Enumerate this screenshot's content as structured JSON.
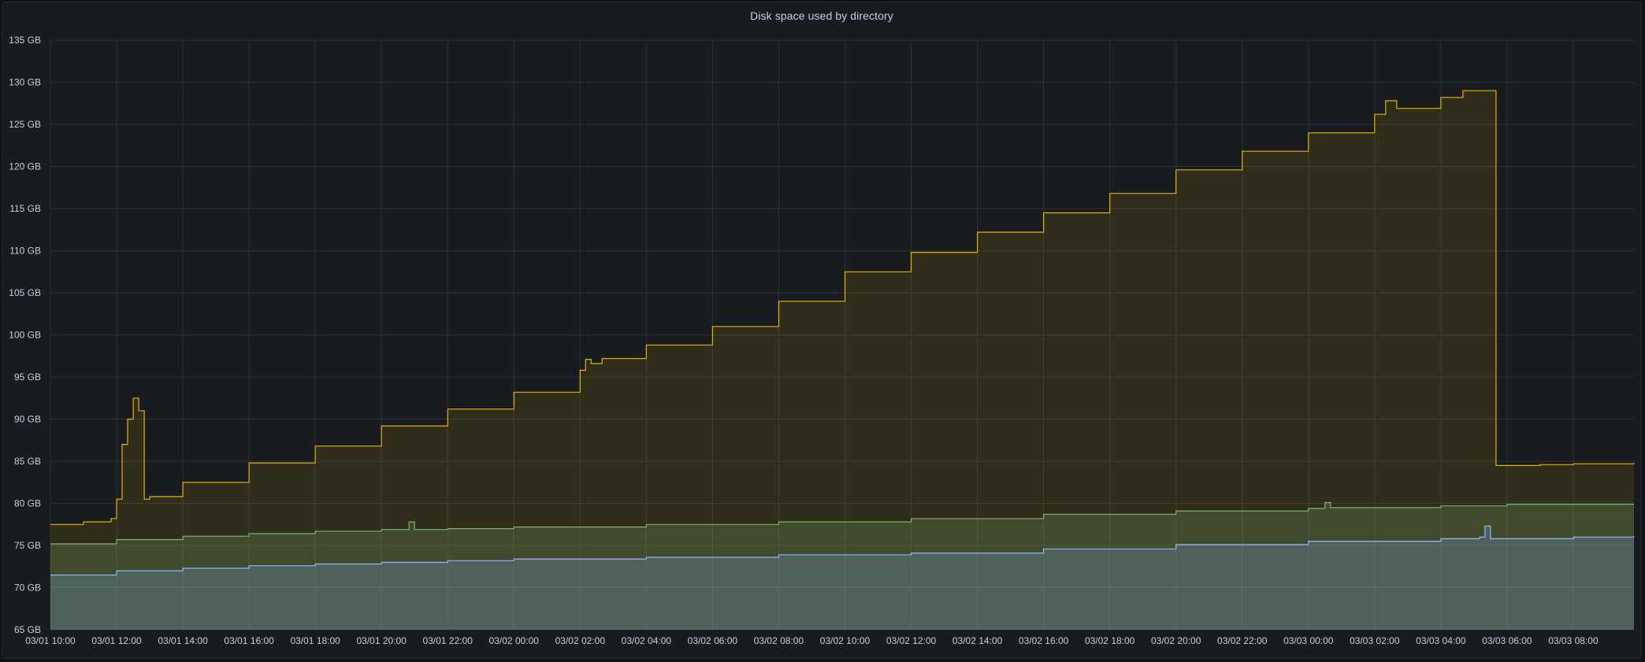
{
  "panel": {
    "title": "Disk space used by directory"
  },
  "colors": {
    "background": "#181b1f",
    "grid": "#2c3035",
    "series_yellow": "#e0b400",
    "series_green": "#7eb26d",
    "series_blue": "#8ab8ff"
  },
  "chart_data": {
    "type": "area",
    "title": "Disk space used by directory",
    "xlabel": "",
    "ylabel": "",
    "ylim": [
      65,
      135
    ],
    "y_unit": "GB",
    "y_ticks": [
      "65 GB",
      "70 GB",
      "75 GB",
      "80 GB",
      "85 GB",
      "90 GB",
      "95 GB",
      "100 GB",
      "105 GB",
      "110 GB",
      "115 GB",
      "120 GB",
      "125 GB",
      "130 GB",
      "135 GB"
    ],
    "y_tick_values": [
      65,
      70,
      75,
      80,
      85,
      90,
      95,
      100,
      105,
      110,
      115,
      120,
      125,
      130,
      135
    ],
    "xlim": [
      "03/01 10:00",
      "03/03 09:50"
    ],
    "x_ticks": [
      "03/01 10:00",
      "03/01 12:00",
      "03/01 14:00",
      "03/01 16:00",
      "03/01 18:00",
      "03/01 20:00",
      "03/01 22:00",
      "03/02 00:00",
      "03/02 02:00",
      "03/02 04:00",
      "03/02 06:00",
      "03/02 08:00",
      "03/02 10:00",
      "03/02 12:00",
      "03/02 14:00",
      "03/02 16:00",
      "03/02 18:00",
      "03/02 20:00",
      "03/02 22:00",
      "03/03 00:00",
      "03/03 02:00",
      "03/03 04:00",
      "03/03 06:00",
      "03/03 08:00"
    ],
    "grid": true,
    "legend": "none",
    "stacked": false,
    "interpolation": "step",
    "series": [
      {
        "color": "#e0b400",
        "x": [
          "03/01 10:00",
          "03/01 11:00",
          "03/01 11:50",
          "03/01 12:00",
          "03/01 12:10",
          "03/01 12:20",
          "03/01 12:30",
          "03/01 12:40",
          "03/01 12:50",
          "03/01 13:00",
          "03/01 14:00",
          "03/01 16:00",
          "03/01 18:00",
          "03/01 20:00",
          "03/01 22:00",
          "03/02 00:00",
          "03/02 02:00",
          "03/02 02:10",
          "03/02 02:20",
          "03/02 02:40",
          "03/02 04:00",
          "03/02 06:00",
          "03/02 08:00",
          "03/02 10:00",
          "03/02 12:00",
          "03/02 14:00",
          "03/02 16:00",
          "03/02 18:00",
          "03/02 20:00",
          "03/02 22:00",
          "03/03 00:00",
          "03/03 02:00",
          "03/03 02:20",
          "03/03 02:40",
          "03/03 04:00",
          "03/03 04:40",
          "03/03 05:30",
          "03/03 05:40",
          "03/03 07:00",
          "03/03 08:00",
          "03/03 09:50"
        ],
        "values": [
          77.5,
          77.8,
          78.2,
          80.5,
          87,
          90,
          92.5,
          91,
          80.5,
          80.8,
          82.5,
          84.8,
          86.8,
          89.2,
          91.2,
          93.2,
          95.8,
          97.1,
          96.6,
          97.2,
          98.8,
          101,
          104,
          107.5,
          109.8,
          112.2,
          114.5,
          116.8,
          119.6,
          121.8,
          124,
          126.2,
          127.8,
          126.9,
          128.2,
          129,
          129,
          84.5,
          84.6,
          84.7,
          84.8
        ]
      },
      {
        "color": "#7eb26d",
        "x": [
          "03/01 10:00",
          "03/01 12:00",
          "03/01 14:00",
          "03/01 16:00",
          "03/01 18:00",
          "03/01 20:00",
          "03/01 20:50",
          "03/01 21:00",
          "03/01 22:00",
          "03/02 00:00",
          "03/02 04:00",
          "03/02 08:00",
          "03/02 12:00",
          "03/02 16:00",
          "03/02 20:00",
          "03/03 00:00",
          "03/03 00:30",
          "03/03 00:40",
          "03/03 04:00",
          "03/03 06:00",
          "03/03 08:00",
          "03/03 09:50"
        ],
        "values": [
          75.2,
          75.7,
          76.1,
          76.4,
          76.7,
          76.9,
          77.8,
          76.9,
          77.0,
          77.2,
          77.5,
          77.8,
          78.2,
          78.7,
          79.1,
          79.4,
          80.1,
          79.5,
          79.7,
          79.9,
          79.9,
          79.9
        ]
      },
      {
        "color": "#8ab8ff",
        "x": [
          "03/01 10:00",
          "03/01 12:00",
          "03/01 14:00",
          "03/01 16:00",
          "03/01 18:00",
          "03/01 20:00",
          "03/01 22:00",
          "03/02 00:00",
          "03/02 04:00",
          "03/02 08:00",
          "03/02 12:00",
          "03/02 16:00",
          "03/02 20:00",
          "03/03 00:00",
          "03/03 04:00",
          "03/03 05:10",
          "03/03 05:20",
          "03/03 05:30",
          "03/03 08:00",
          "03/03 09:50"
        ],
        "values": [
          71.5,
          72.0,
          72.3,
          72.6,
          72.8,
          73.0,
          73.2,
          73.4,
          73.6,
          73.9,
          74.1,
          74.6,
          75.1,
          75.5,
          75.8,
          76.0,
          77.3,
          75.8,
          76.0,
          76.1
        ]
      }
    ]
  }
}
